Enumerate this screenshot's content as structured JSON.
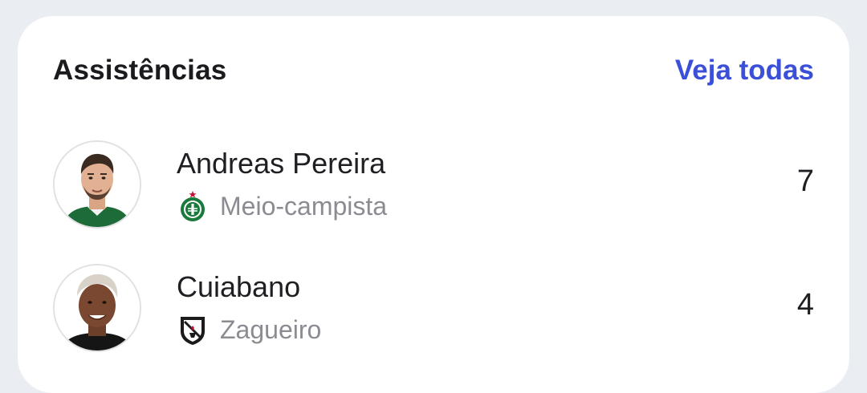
{
  "card": {
    "title": "Assistências",
    "see_all_label": "Veja todas"
  },
  "players": [
    {
      "name": "Andreas Pereira",
      "position": "Meio-campista",
      "team_crest_icon": "palmeiras-crest-icon",
      "assists": "7"
    },
    {
      "name": "Cuiabano",
      "position": "Zagueiro",
      "team_crest_icon": "vasco-crest-icon",
      "assists": "4"
    }
  ],
  "colors": {
    "accent": "#3b4fd8",
    "palmeiras_green": "#1a7a3c",
    "vasco_black": "#1b1b1b"
  }
}
